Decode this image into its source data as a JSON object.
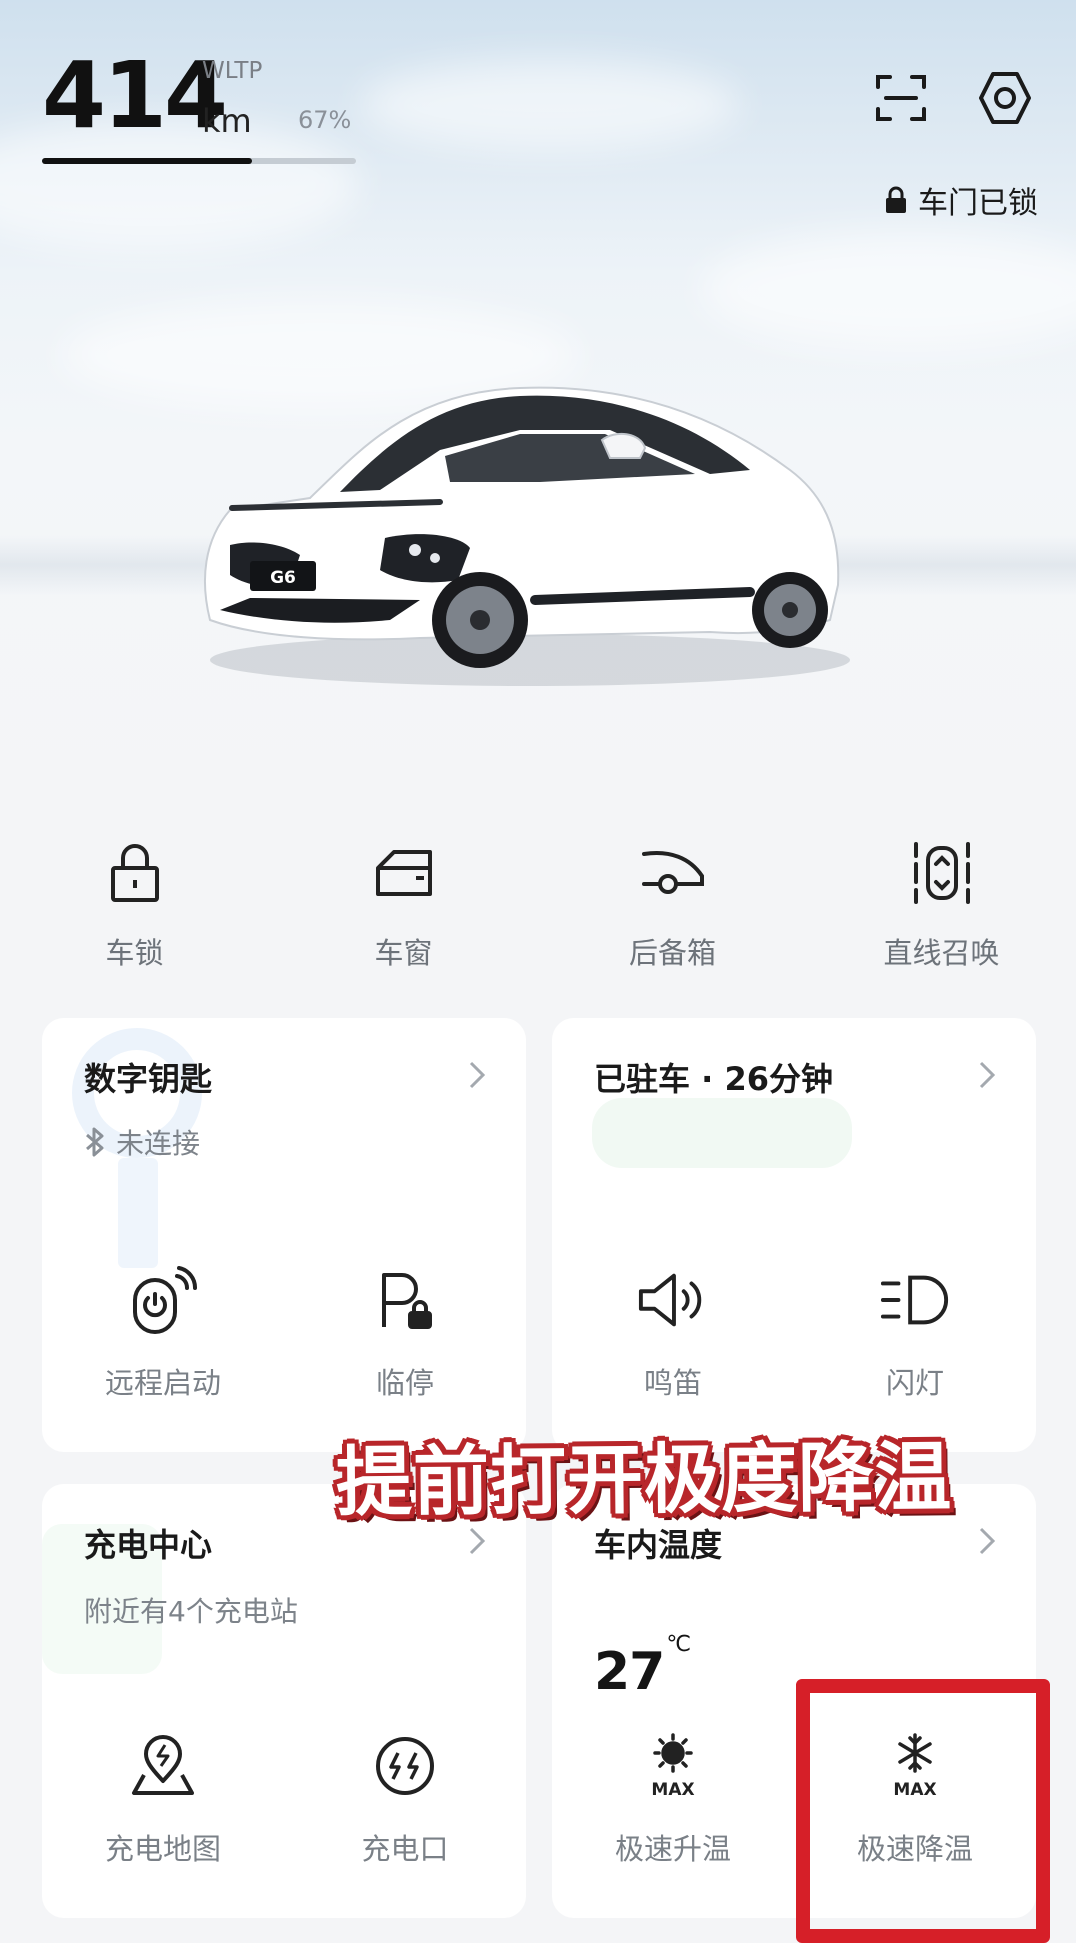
{
  "range": {
    "value": "414",
    "unit": "km",
    "standard": "WLTP",
    "battery_percent": "67%",
    "battery_level": 0.67
  },
  "door_status": {
    "label": "车门已锁"
  },
  "quick_controls": [
    {
      "label": "车锁",
      "icon": "lock-icon"
    },
    {
      "label": "车窗",
      "icon": "window-icon"
    },
    {
      "label": "后备箱",
      "icon": "trunk-icon"
    },
    {
      "label": "直线召唤",
      "icon": "summon-icon"
    }
  ],
  "digital_key": {
    "title": "数字钥匙",
    "status": "未连接",
    "actions": [
      {
        "label": "远程启动"
      },
      {
        "label": "临停"
      }
    ]
  },
  "parking": {
    "title": "已驻车 · 26分钟",
    "actions": [
      {
        "label": "鸣笛"
      },
      {
        "label": "闪灯"
      }
    ]
  },
  "charging": {
    "title": "充电中心",
    "subtitle": "附近有4个充电站",
    "actions": [
      {
        "label": "充电地图"
      },
      {
        "label": "充电口"
      }
    ]
  },
  "climate": {
    "title": "车内温度",
    "temperature": "27",
    "unit": "℃",
    "actions": [
      {
        "label": "极速升温"
      },
      {
        "label": "极速降温"
      }
    ]
  },
  "car": {
    "plate": "G6"
  },
  "caption": "提前打开极度降温",
  "colors": {
    "accent_red": "#d61f28",
    "text_primary": "#1a1a1a",
    "text_secondary": "#7a8087"
  }
}
